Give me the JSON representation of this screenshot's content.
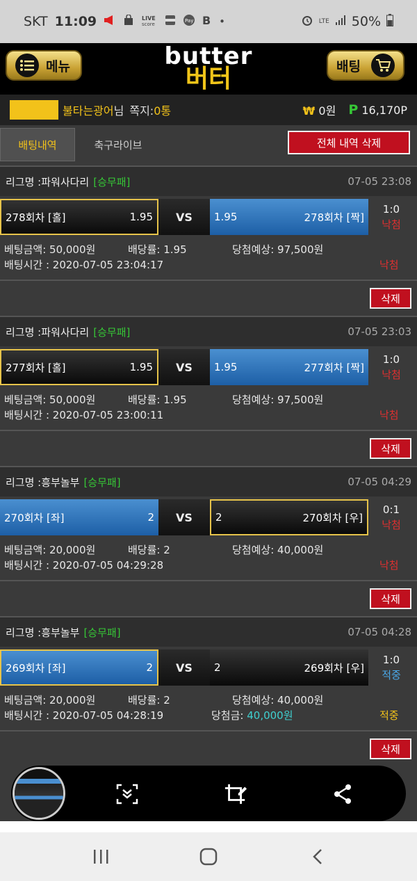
{
  "status_bar": {
    "carrier": "SKT",
    "time": "11:09",
    "network": "LTE",
    "battery": "50%"
  },
  "header": {
    "menu_label": "메뉴",
    "logo_en": "butter",
    "logo_ko": "버터",
    "bet_label": "배팅"
  },
  "user": {
    "name": "불타는광어",
    "suffix": "님",
    "msg_label": "쪽지:",
    "msg_count": "0통",
    "won_symbol": "₩",
    "money": "0원",
    "point_symbol": "P",
    "points": "16,170P"
  },
  "tabs": {
    "bet_history": "배팅내역",
    "soccer_live": "축구라이브",
    "delete_all": "전체 내역 삭제"
  },
  "labels": {
    "league_prefix": "리그명 : ",
    "vs": "VS",
    "amount_label": "베팅금액: ",
    "odds_label": "배당률: ",
    "expect_label": "당첨예상: ",
    "time_label": "배팅시간 : ",
    "winamt_label": "당첨금: ",
    "delete": "삭제"
  },
  "bets": [
    {
      "league": "파워사다리",
      "type": "[승무패]",
      "date": "07-05 23:08",
      "left_team": "278회차 [홀]",
      "left_odds": "1.95",
      "right_team": "278회차 [짝]",
      "right_odds": "1.95",
      "score": "1:0",
      "status": "낙첨",
      "amount": "50,000원",
      "odds": "1.95",
      "expect": "97,500원",
      "bet_time": "2020-07-05 23:04:17",
      "final": "낙첨"
    },
    {
      "league": "파워사다리",
      "type": "[승무패]",
      "date": "07-05 23:03",
      "left_team": "277회차 [홀]",
      "left_odds": "1.95",
      "right_team": "277회차 [짝]",
      "right_odds": "1.95",
      "score": "1:0",
      "status": "낙첨",
      "amount": "50,000원",
      "odds": "1.95",
      "expect": "97,500원",
      "bet_time": "2020-07-05 23:00:11",
      "final": "낙첨"
    },
    {
      "league": "흥부놀부",
      "type": "[승무패]",
      "date": "07-05 04:29",
      "left_team": "270회차 [좌]",
      "left_odds": "2",
      "right_team": "270회차 [우]",
      "right_odds": "2",
      "score": "0:1",
      "status": "낙첨",
      "amount": "20,000원",
      "odds": "2",
      "expect": "40,000원",
      "bet_time": "2020-07-05 04:29:28",
      "final": "낙첨"
    },
    {
      "league": "흥부놀부",
      "type": "[승무패]",
      "date": "07-05 04:28",
      "left_team": "269회차 [좌]",
      "left_odds": "2",
      "right_team": "269회차 [우]",
      "right_odds": "2",
      "score": "1:0",
      "status": "적중",
      "amount": "20,000원",
      "odds": "2",
      "expect": "40,000원",
      "bet_time": "2020-07-05 04:28:19",
      "win_amount": "40,000원",
      "final": "적중"
    }
  ],
  "colors": {
    "accent_gold": "#f2c21a",
    "win_green": "#36c636",
    "lose_red": "#e03030",
    "hit_blue": "#4aa8e8",
    "delete_red": "#c0101f"
  }
}
